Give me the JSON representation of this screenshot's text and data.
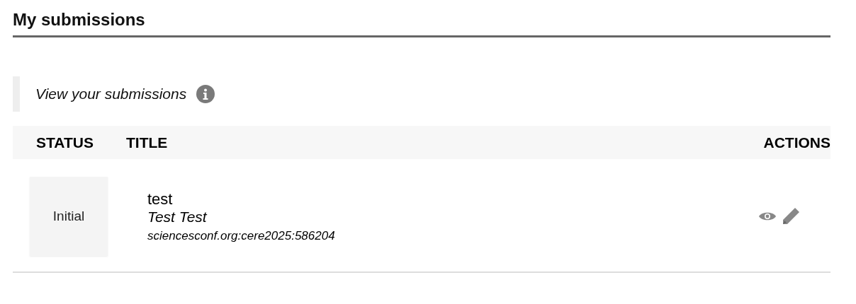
{
  "page_title": "My submissions",
  "notice": {
    "text": "View your submissions"
  },
  "table": {
    "columns": [
      "STATUS",
      "TITLE",
      "ACTIONS"
    ],
    "rows": [
      {
        "status": "Initial",
        "title": "test",
        "authors": "Test Test",
        "identifier": "sciencesconf.org:cere2025:586204",
        "actions": [
          {
            "kind": "view"
          },
          {
            "kind": "edit"
          }
        ]
      }
    ]
  }
}
